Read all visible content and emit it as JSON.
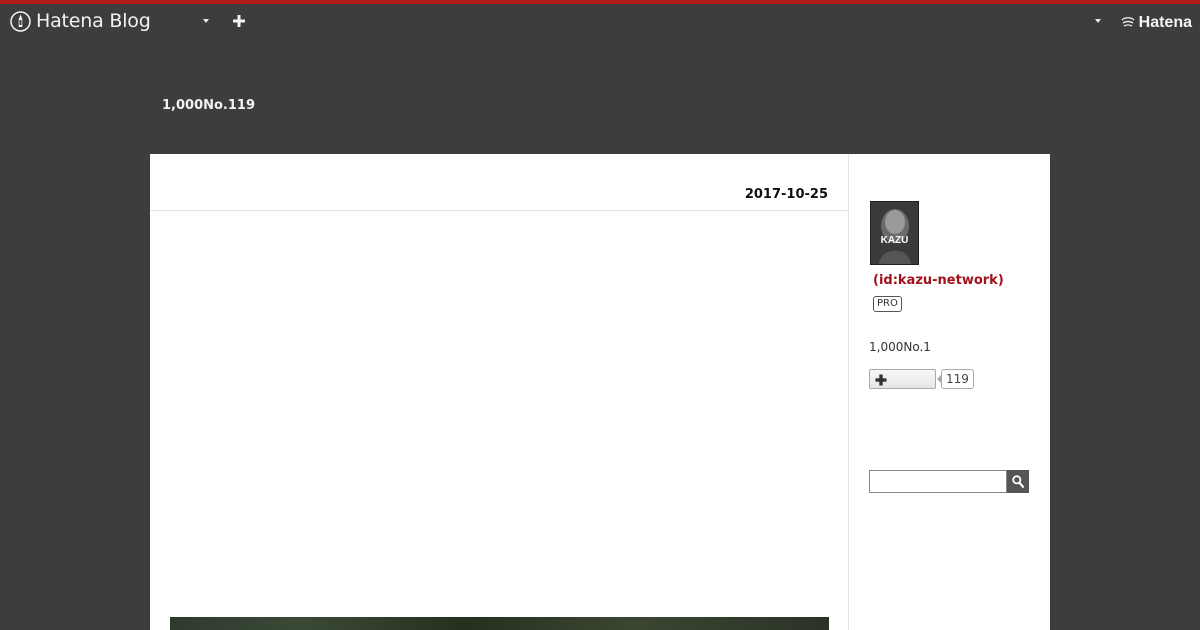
{
  "header": {
    "logo_text": "Hatena Blog",
    "brand_text": "Hatena"
  },
  "blog": {
    "title": "1,000No.119"
  },
  "entry": {
    "date": "2017-10-25"
  },
  "sidebar": {
    "avatar_text": "KAZU",
    "profile_id": "(id:kazu-network)",
    "pro_badge": "PRO",
    "description": "1,000No.1",
    "subscriber_count": "119",
    "search": {
      "placeholder": ""
    }
  },
  "colors": {
    "accent": "#b01a1a",
    "background": "#3d3d3d",
    "profile_link": "#a1121b"
  }
}
